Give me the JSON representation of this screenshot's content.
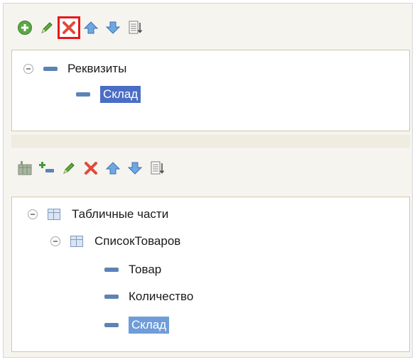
{
  "top_toolbar": {
    "buttons": [
      "add-icon",
      "edit-icon",
      "delete-icon",
      "move-up-icon",
      "move-down-icon",
      "sort-list-icon"
    ]
  },
  "attributes_tree": {
    "root_label": "Реквизиты",
    "items": [
      {
        "label": "Склад",
        "selected": true
      }
    ]
  },
  "bottom_toolbar": {
    "buttons": [
      "add-table-icon",
      "add-column-icon",
      "edit-icon",
      "delete-icon",
      "move-up-icon",
      "move-down-icon",
      "sort-list-icon"
    ]
  },
  "tables_tree": {
    "root_label": "Табличные части",
    "table_label": "СписокТоваров",
    "items": [
      {
        "label": "Товар",
        "selected": false
      },
      {
        "label": "Количество",
        "selected": false
      },
      {
        "label": "Склад",
        "selected": true
      }
    ]
  },
  "colors": {
    "selection_primary": "#4a6ec6",
    "selection_secondary": "#6f9dd9",
    "highlight": "#e8171a"
  }
}
